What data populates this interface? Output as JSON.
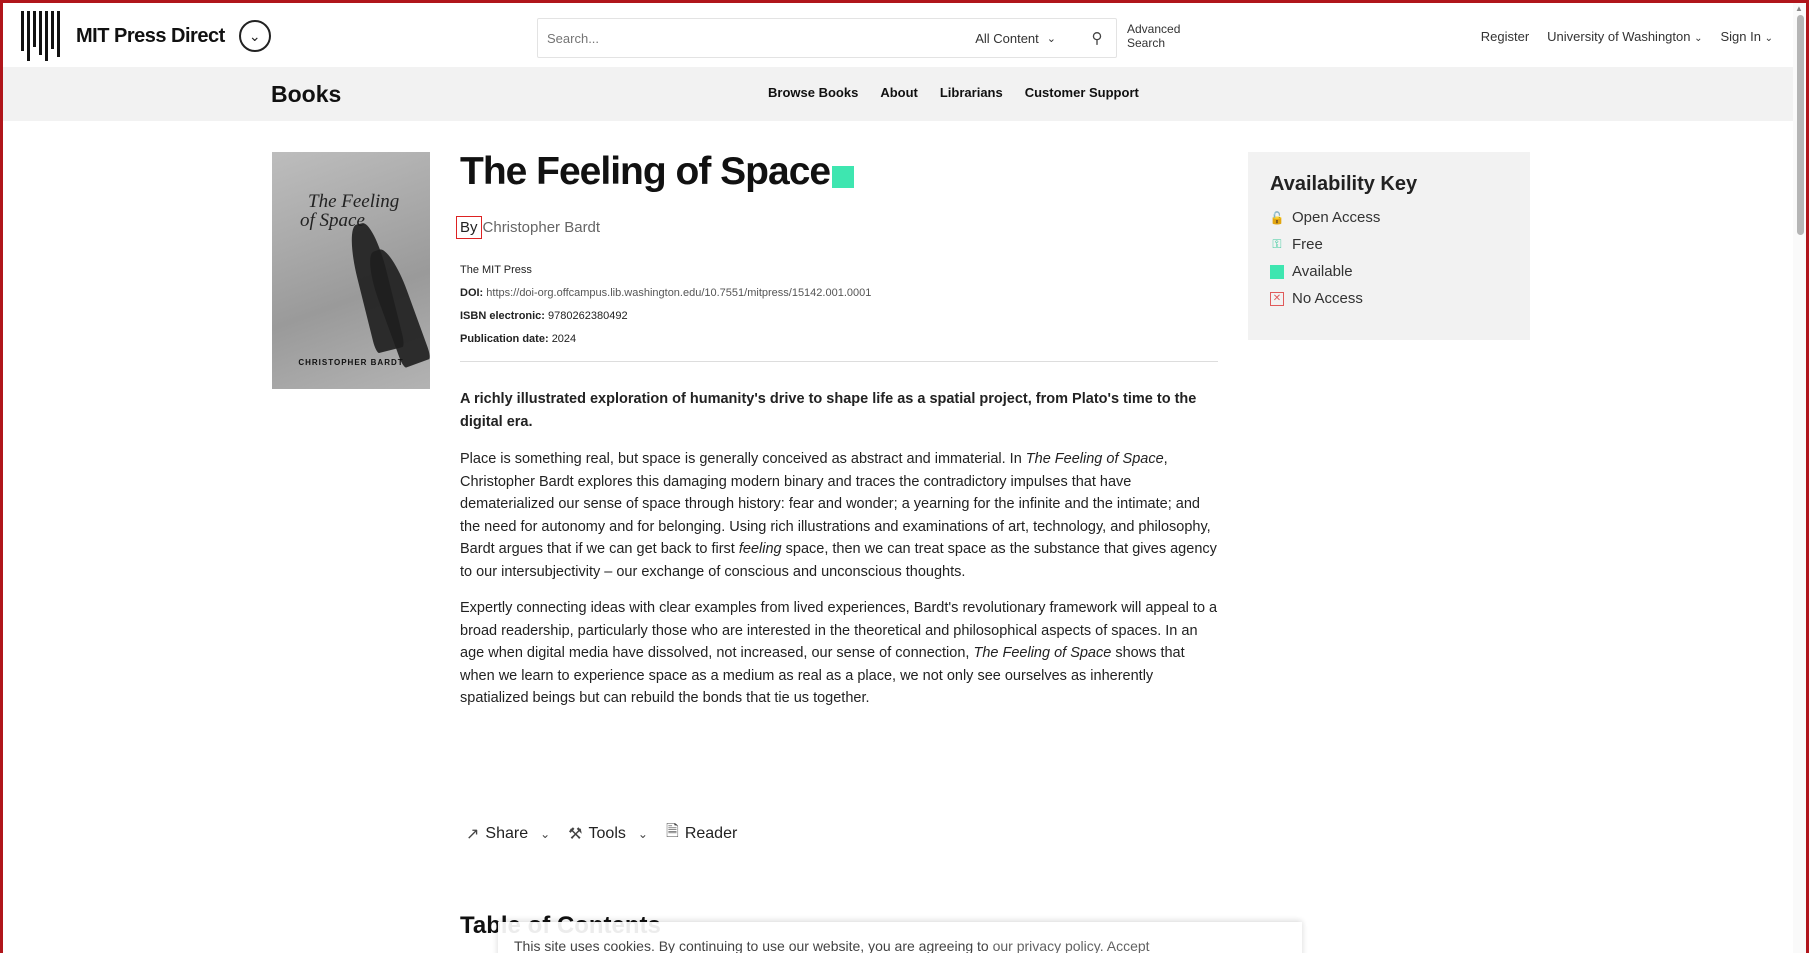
{
  "header": {
    "brand": "MIT Press Direct",
    "search": {
      "placeholder": "Search...",
      "scope": "All Content"
    },
    "advanced_search": [
      "Advanced",
      "Search"
    ],
    "register": "Register",
    "institution": "University of Washington",
    "sign_in": "Sign In"
  },
  "subnav": {
    "title": "Books",
    "links": [
      "Browse Books",
      "About",
      "Librarians",
      "Customer Support"
    ]
  },
  "cover": {
    "title_line1": "The Feeling",
    "title_line2": "of Space",
    "author": "CHRISTOPHER BARDT"
  },
  "book": {
    "title": "The Feeling of Space",
    "by_label": "By",
    "author": "Christopher Bardt",
    "publisher": "The MIT Press",
    "doi_label": "DOI:",
    "doi": "https://doi-org.offcampus.lib.washington.edu/10.7551/mitpress/15142.001.0001",
    "isbn_label": "ISBN electronic:",
    "isbn": "9780262380492",
    "pubdate_label": "Publication date:",
    "pubdate": "2024",
    "lead": "A richly illustrated exploration of humanity's drive to shape life as a spatial project, from Plato's time to the digital era.",
    "p1_a": "Place is something real, but space is generally conceived as abstract and immaterial. In ",
    "p1_title": "The Feeling of Space",
    "p1_b": ", Christopher Bardt explores this damaging modern binary and traces the contradictory impulses that have dematerialized our sense of space through history: fear and wonder; a yearning for the infinite and the intimate; and the need for autonomy and for belonging. Using rich illustrations and examinations of art, technology, and philosophy, Bardt argues that if we can get back to first ",
    "p1_em": "feeling",
    "p1_c": " space, then we can treat space as the substance that gives agency to our intersubjectivity – our exchange of conscious and unconscious thoughts.",
    "p2_a": "Expertly connecting ideas with clear examples from lived experiences, Bardt's revolutionary framework will appeal to a broad readership, particularly those who are interested in the theoretical and philosophical aspects of spaces. In an age when digital media have dissolved, not increased, our sense of connection, ",
    "p2_title": "The Feeling of Space",
    "p2_b": " shows that when we learn to experience space as a medium as real as a place, we not only see ourselves as inherently spatialized beings but can rebuild the bonds that tie us together."
  },
  "actions": {
    "share": "Share",
    "tools": "Tools",
    "reader": "Reader"
  },
  "toc_heading": "Table of Contents",
  "availability_key": {
    "title": "Availability Key",
    "items": [
      "Open Access",
      "Free",
      "Available",
      "No Access"
    ]
  },
  "cookie": {
    "text": "This site uses cookies. By continuing to use our website, you are agreeing to ",
    "link": "our privacy policy.",
    "accept": "Accept"
  },
  "colors": {
    "available": "#3ee6b0",
    "frame": "#b0151b",
    "no_access": "#e05a5a"
  }
}
